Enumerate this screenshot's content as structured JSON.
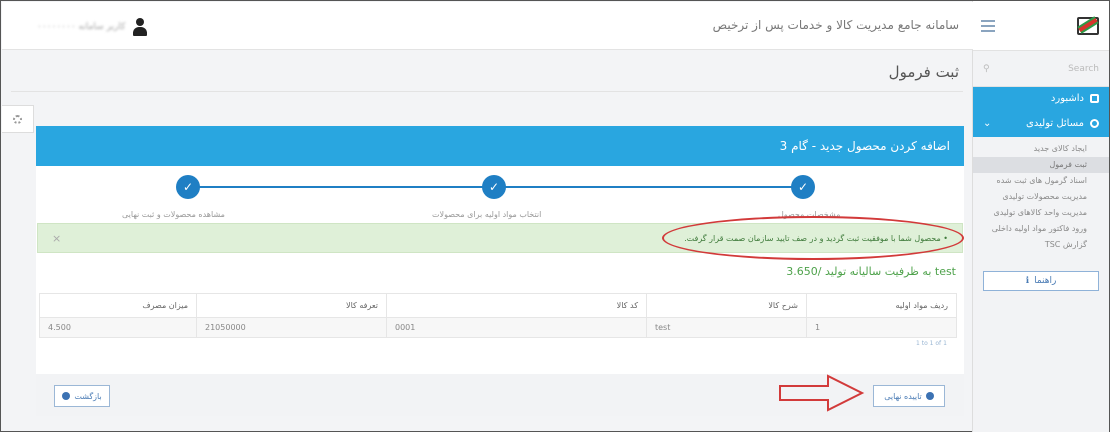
{
  "header": {
    "app_title": "سامانه جامع مدیریت کالا و خدمات پس از ترخیص",
    "user_name": "کاربر سامانه ۰۰۰۰۰۰۰۰"
  },
  "sidebar": {
    "search_placeholder": "Search",
    "items": [
      {
        "label": "داشبورد",
        "icon": "dashboard-icon"
      },
      {
        "label": "مسائل تولیدی",
        "icon": "gear-icon"
      }
    ],
    "sub_items": [
      "ایجاد کالای جدید",
      "ثبت فرمول",
      "اسناد گرمول های ثبت شده",
      "مدیریت محصولات تولیدی",
      "مدیریت واحد کالاهای تولیدی",
      "ورود فاکتور مواد اولیه داخلی",
      "گزارش TSC"
    ],
    "selected_sub_index": 1,
    "help_label": "راهنما"
  },
  "page": {
    "title": "ثبت فرمول"
  },
  "card": {
    "header": "اضافه کردن محصول جدید - گام 3",
    "steps": [
      "مشخصات محصول",
      "انتخاب مواد اولیه برای محصولات",
      "مشاهده محصولات و ثبت نهایی"
    ],
    "alert": "• محصول شما با موفقیت ثبت گردید و در صف تایید سازمان صمت قرار گرفت.",
    "capacity_text": "test به ظرفیت سالیانه تولید /3.650",
    "table": {
      "headers": [
        "ردیف مواد اولیه",
        "شرح کالا",
        "کد کالا",
        "تعرفه کالا",
        "میزان مصرف"
      ],
      "rows": [
        [
          "1",
          "test",
          "0001",
          "21050000",
          "4.500"
        ]
      ],
      "footer": "1 to 1 of 1"
    },
    "confirm_button": "تاییده نهایی",
    "back_button": "بازگشت"
  },
  "colors": {
    "primary": "#29a6e0",
    "step": "#1f7fc4",
    "success_bg": "#dff0d8",
    "annotation": "#d23a3a"
  }
}
